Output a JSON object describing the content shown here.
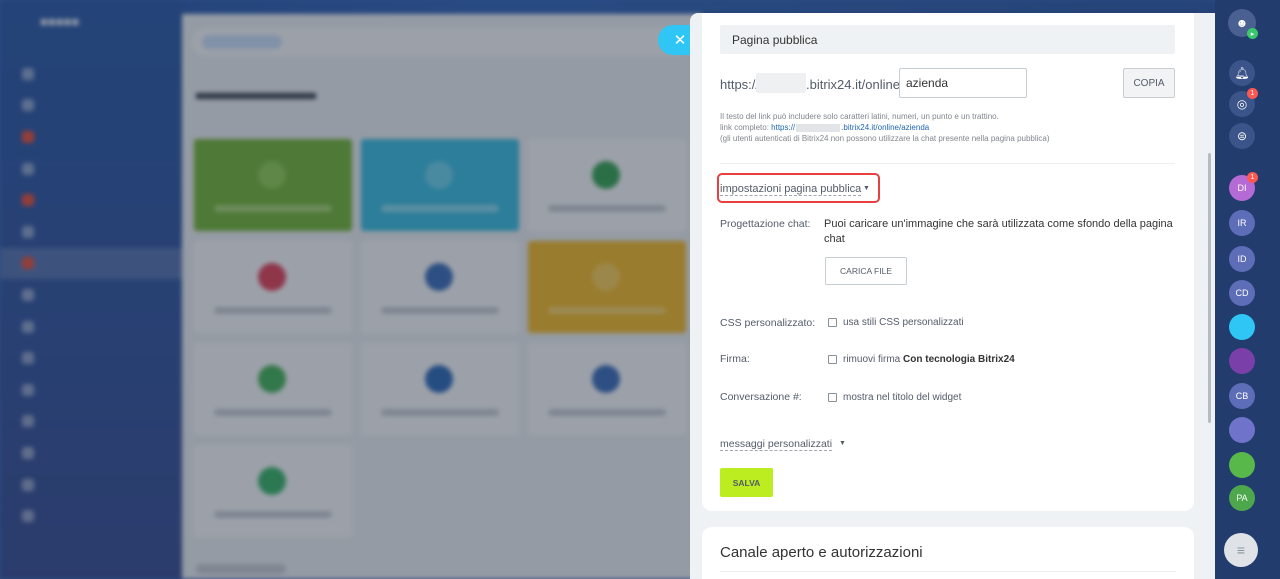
{
  "close": {
    "icon": "close-icon",
    "glyph": "✕"
  },
  "panel": {
    "section_title": "Pagina pubblica",
    "url": {
      "prefix": "https://",
      "suffix": ".bitrix24.it/online/",
      "value": "azienda",
      "copy_label": "COPIA"
    },
    "hints": {
      "line1": "Il testo del link può includere solo caratteri latini, numeri, un punto e un trattino.",
      "line2_label": "link completo: ",
      "line2_link_prefix": "https://",
      "line2_link_suffix": ".bitrix24.it/online/azienda",
      "line3": "(gli utenti autenticati di Bitrix24 non possono utilizzare la chat presente nella pagina pubblica)"
    },
    "settings_toggle": "impostazioni pagina pubblica",
    "chat_design": {
      "label": "Progettazione chat:",
      "description": "Puoi caricare un'immagine che sarà utilizzata come sfondo della pagina chat",
      "upload_label": "CARICA FILE"
    },
    "css": {
      "label": "CSS personalizzato:",
      "option": "usa stili CSS personalizzati",
      "checked": false
    },
    "signature": {
      "label": "Firma:",
      "option": "rimuovi firma ",
      "option_bold": "Con tecnologia Bitrix24",
      "checked": false
    },
    "conversation": {
      "label": "Conversazione #:",
      "option": "mostra nel titolo del widget",
      "checked": false
    },
    "custom_messages": "messaggi personalizzati",
    "save_label": "SALVA",
    "next_section_title": "Canale aperto e autorizzazioni"
  },
  "rail": {
    "items": [
      {
        "name": "bell-icon",
        "glyph": "🔔︎",
        "badge": ""
      },
      {
        "name": "activity-icon",
        "glyph": "◎",
        "badge": "1"
      },
      {
        "name": "chat-search-icon",
        "glyph": "⊜",
        "badge": ""
      },
      {
        "name": "avatar-di",
        "text": "DI",
        "badge": "1",
        "color": "#b46bd6"
      },
      {
        "name": "avatar-ir",
        "text": "IR",
        "badge": "",
        "color": "#5e6db8"
      },
      {
        "name": "avatar-id",
        "text": "ID",
        "badge": "",
        "color": "#5e6db8"
      },
      {
        "name": "avatar-cd",
        "text": "CD",
        "badge": "",
        "color": "#5e6db8"
      },
      {
        "name": "chat-bubble-icon",
        "text": "",
        "badge": "",
        "color": "#2fc6f6"
      },
      {
        "name": "avatar-colorful",
        "text": "",
        "badge": "",
        "color": "#7a3fa8"
      },
      {
        "name": "avatar-cb",
        "text": "CB",
        "badge": "",
        "color": "#5e6db8"
      },
      {
        "name": "group-icon",
        "text": "",
        "badge": "",
        "color": "#6f73c9"
      },
      {
        "name": "group-green-icon",
        "text": "",
        "badge": "",
        "color": "#58b84a"
      },
      {
        "name": "avatar-pa",
        "text": "PA",
        "badge": "",
        "color": "#4ca84a"
      }
    ],
    "bottom_glyph": "≡"
  },
  "colors": {
    "accent": "#2fc6f6",
    "save": "#bbed21",
    "highlight": "#e84040"
  }
}
